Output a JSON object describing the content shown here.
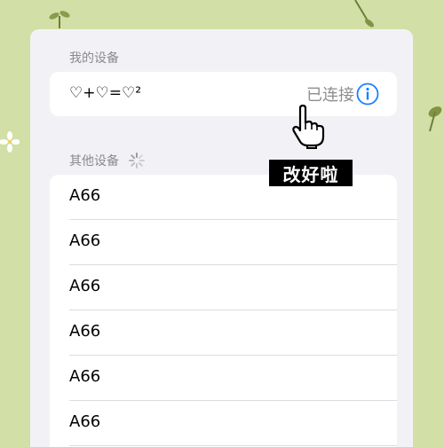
{
  "my_devices": {
    "header": "我的设备",
    "device_name": "♡+♡=♡²",
    "status": "已连接"
  },
  "other_devices": {
    "header": "其他设备",
    "items": [
      "A66",
      "A66",
      "A66",
      "A66",
      "A66",
      "A66"
    ]
  },
  "overlay": {
    "caption": "改好啦"
  },
  "colors": {
    "background": "#d2dfa6",
    "panel": "#f2f2f6",
    "accent": "#1a80ff"
  },
  "icons": [
    "info-icon",
    "loading-spinner-icon",
    "hand-pointer-icon",
    "flower-icon",
    "leaf-icon"
  ]
}
